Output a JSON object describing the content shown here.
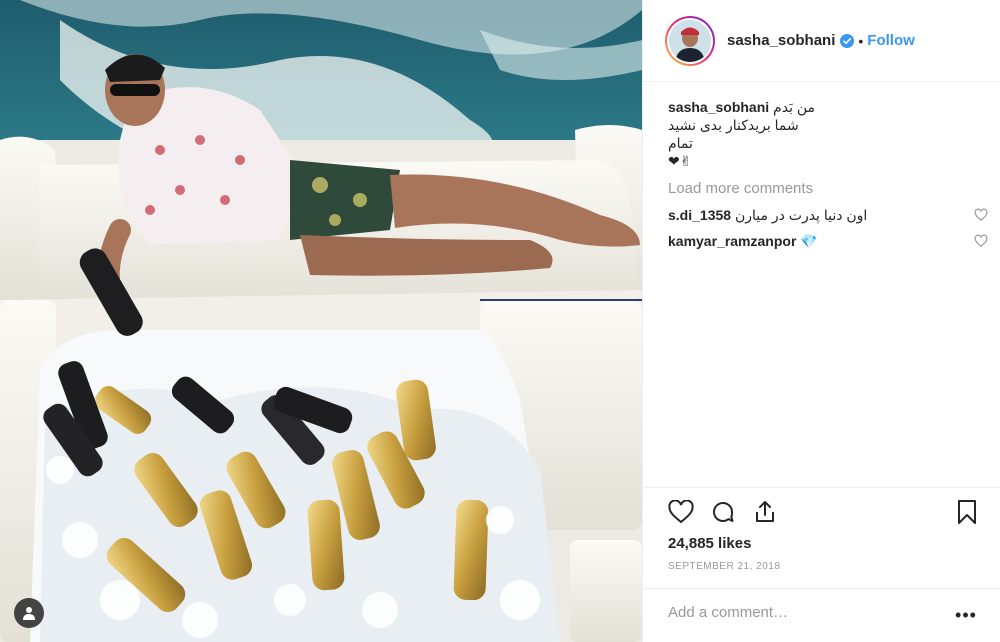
{
  "post": {
    "username": "sasha_sobhani",
    "verified": true,
    "follow_label": "Follow",
    "separator": "•"
  },
  "caption": {
    "username": "sasha_sobhani",
    "lines": [
      "من بَدم",
      "شما بریدکنار بدی نشید",
      "تمام",
      "❤✌"
    ]
  },
  "comments": {
    "load_more_label": "Load more comments",
    "items": [
      {
        "username": "s.di_1358",
        "text": "اون دنیا پدرت در میارن"
      },
      {
        "username": "kamyar_ramzanpor",
        "text": "💎"
      }
    ]
  },
  "actions": {
    "likes_text": "24,885 likes",
    "date_text": "SEPTEMBER 21, 2018",
    "add_comment_placeholder": "Add a comment…",
    "more_label": "•••"
  },
  "colors": {
    "accent": "#3897f0",
    "muted": "#999999",
    "text": "#262626",
    "border": "#efefef"
  },
  "icons": [
    "verified-badge-icon",
    "heart-icon",
    "comment-icon",
    "share-icon",
    "bookmark-icon",
    "more-icon",
    "user-tag-icon"
  ]
}
